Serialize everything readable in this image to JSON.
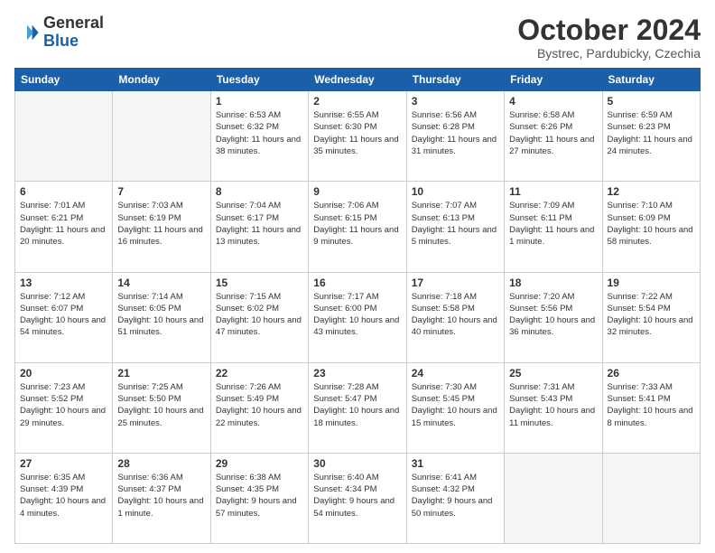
{
  "header": {
    "logo_general": "General",
    "logo_blue": "Blue",
    "month_title": "October 2024",
    "location": "Bystrec, Pardubicky, Czechia"
  },
  "weekdays": [
    "Sunday",
    "Monday",
    "Tuesday",
    "Wednesday",
    "Thursday",
    "Friday",
    "Saturday"
  ],
  "weeks": [
    [
      {
        "day": "",
        "info": ""
      },
      {
        "day": "",
        "info": ""
      },
      {
        "day": "1",
        "info": "Sunrise: 6:53 AM\nSunset: 6:32 PM\nDaylight: 11 hours and 38 minutes."
      },
      {
        "day": "2",
        "info": "Sunrise: 6:55 AM\nSunset: 6:30 PM\nDaylight: 11 hours and 35 minutes."
      },
      {
        "day": "3",
        "info": "Sunrise: 6:56 AM\nSunset: 6:28 PM\nDaylight: 11 hours and 31 minutes."
      },
      {
        "day": "4",
        "info": "Sunrise: 6:58 AM\nSunset: 6:26 PM\nDaylight: 11 hours and 27 minutes."
      },
      {
        "day": "5",
        "info": "Sunrise: 6:59 AM\nSunset: 6:23 PM\nDaylight: 11 hours and 24 minutes."
      }
    ],
    [
      {
        "day": "6",
        "info": "Sunrise: 7:01 AM\nSunset: 6:21 PM\nDaylight: 11 hours and 20 minutes."
      },
      {
        "day": "7",
        "info": "Sunrise: 7:03 AM\nSunset: 6:19 PM\nDaylight: 11 hours and 16 minutes."
      },
      {
        "day": "8",
        "info": "Sunrise: 7:04 AM\nSunset: 6:17 PM\nDaylight: 11 hours and 13 minutes."
      },
      {
        "day": "9",
        "info": "Sunrise: 7:06 AM\nSunset: 6:15 PM\nDaylight: 11 hours and 9 minutes."
      },
      {
        "day": "10",
        "info": "Sunrise: 7:07 AM\nSunset: 6:13 PM\nDaylight: 11 hours and 5 minutes."
      },
      {
        "day": "11",
        "info": "Sunrise: 7:09 AM\nSunset: 6:11 PM\nDaylight: 11 hours and 1 minute."
      },
      {
        "day": "12",
        "info": "Sunrise: 7:10 AM\nSunset: 6:09 PM\nDaylight: 10 hours and 58 minutes."
      }
    ],
    [
      {
        "day": "13",
        "info": "Sunrise: 7:12 AM\nSunset: 6:07 PM\nDaylight: 10 hours and 54 minutes."
      },
      {
        "day": "14",
        "info": "Sunrise: 7:14 AM\nSunset: 6:05 PM\nDaylight: 10 hours and 51 minutes."
      },
      {
        "day": "15",
        "info": "Sunrise: 7:15 AM\nSunset: 6:02 PM\nDaylight: 10 hours and 47 minutes."
      },
      {
        "day": "16",
        "info": "Sunrise: 7:17 AM\nSunset: 6:00 PM\nDaylight: 10 hours and 43 minutes."
      },
      {
        "day": "17",
        "info": "Sunrise: 7:18 AM\nSunset: 5:58 PM\nDaylight: 10 hours and 40 minutes."
      },
      {
        "day": "18",
        "info": "Sunrise: 7:20 AM\nSunset: 5:56 PM\nDaylight: 10 hours and 36 minutes."
      },
      {
        "day": "19",
        "info": "Sunrise: 7:22 AM\nSunset: 5:54 PM\nDaylight: 10 hours and 32 minutes."
      }
    ],
    [
      {
        "day": "20",
        "info": "Sunrise: 7:23 AM\nSunset: 5:52 PM\nDaylight: 10 hours and 29 minutes."
      },
      {
        "day": "21",
        "info": "Sunrise: 7:25 AM\nSunset: 5:50 PM\nDaylight: 10 hours and 25 minutes."
      },
      {
        "day": "22",
        "info": "Sunrise: 7:26 AM\nSunset: 5:49 PM\nDaylight: 10 hours and 22 minutes."
      },
      {
        "day": "23",
        "info": "Sunrise: 7:28 AM\nSunset: 5:47 PM\nDaylight: 10 hours and 18 minutes."
      },
      {
        "day": "24",
        "info": "Sunrise: 7:30 AM\nSunset: 5:45 PM\nDaylight: 10 hours and 15 minutes."
      },
      {
        "day": "25",
        "info": "Sunrise: 7:31 AM\nSunset: 5:43 PM\nDaylight: 10 hours and 11 minutes."
      },
      {
        "day": "26",
        "info": "Sunrise: 7:33 AM\nSunset: 5:41 PM\nDaylight: 10 hours and 8 minutes."
      }
    ],
    [
      {
        "day": "27",
        "info": "Sunrise: 6:35 AM\nSunset: 4:39 PM\nDaylight: 10 hours and 4 minutes."
      },
      {
        "day": "28",
        "info": "Sunrise: 6:36 AM\nSunset: 4:37 PM\nDaylight: 10 hours and 1 minute."
      },
      {
        "day": "29",
        "info": "Sunrise: 6:38 AM\nSunset: 4:35 PM\nDaylight: 9 hours and 57 minutes."
      },
      {
        "day": "30",
        "info": "Sunrise: 6:40 AM\nSunset: 4:34 PM\nDaylight: 9 hours and 54 minutes."
      },
      {
        "day": "31",
        "info": "Sunrise: 6:41 AM\nSunset: 4:32 PM\nDaylight: 9 hours and 50 minutes."
      },
      {
        "day": "",
        "info": ""
      },
      {
        "day": "",
        "info": ""
      }
    ]
  ]
}
